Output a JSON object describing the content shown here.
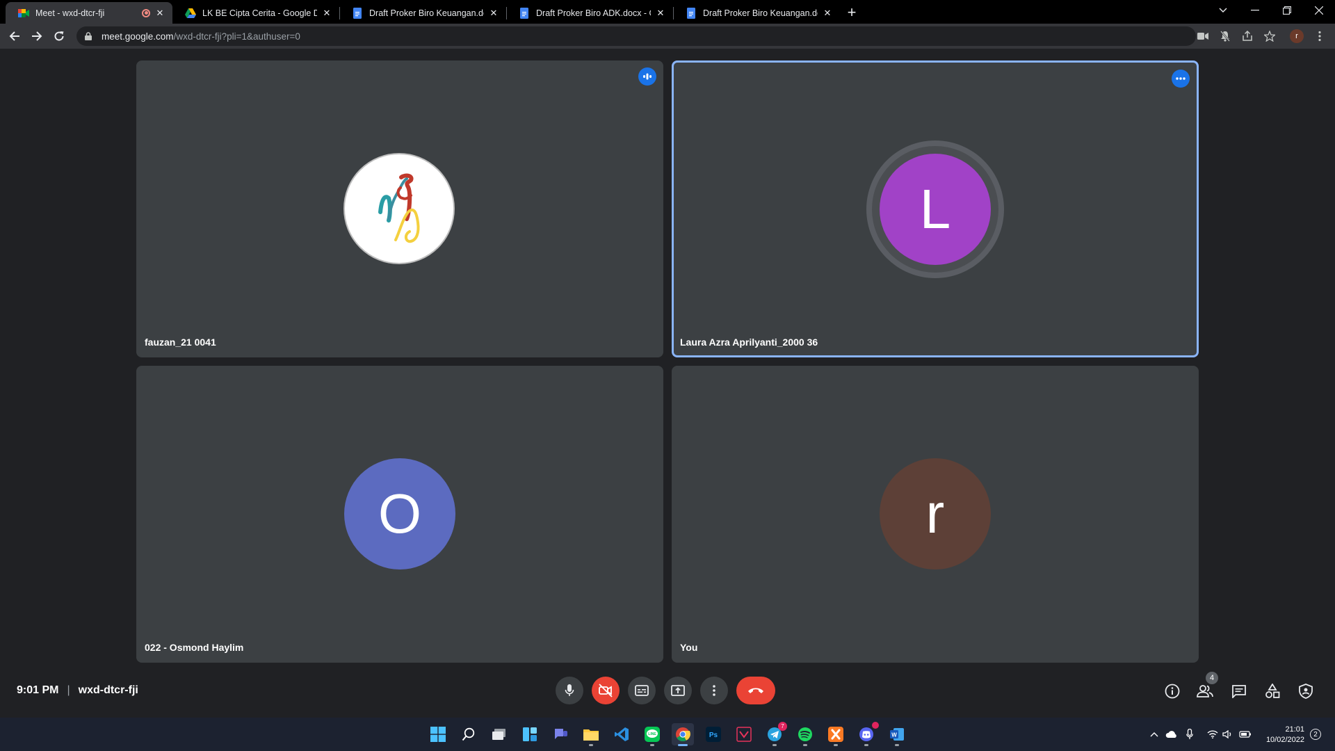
{
  "browser": {
    "tabs": [
      {
        "title": "Meet - wxd-dtcr-fji",
        "favicon": "meet-icon",
        "active": true,
        "recording": true
      },
      {
        "title": "LK BE Cipta Cerita - Google Drive",
        "favicon": "drive-icon"
      },
      {
        "title": "Draft Proker Biro Keuangan.docx",
        "favicon": "docs-icon"
      },
      {
        "title": "Draft Proker Biro ADK.docx - Goo",
        "favicon": "docs-icon"
      },
      {
        "title": "Draft Proker Biro Keuangan.docx",
        "favicon": "docs-icon"
      }
    ],
    "url_host": "meet.google.com",
    "url_path": "/wxd-dtcr-fji?pli=1&authuser=0",
    "profile_initial": "r"
  },
  "meet": {
    "participants": [
      {
        "name": "fauzan_21 0041",
        "avatar": "logo",
        "badge": "audio-indicator-icon"
      },
      {
        "name": "Laura Azra Aprilyanti_2000 36",
        "initial": "L",
        "avatar_color": "#a142c7",
        "speaking": true,
        "badge": "more-options-icon"
      },
      {
        "name": "022 - Osmond Haylim",
        "initial": "O",
        "avatar_color": "#5c6bc0"
      },
      {
        "name": "You",
        "initial": "r",
        "avatar_color": "#5d4037"
      }
    ],
    "time": "9:01 PM",
    "meeting_code": "wxd-dtcr-fji",
    "people_count": "4"
  },
  "taskbar": {
    "time": "21:01",
    "date": "10/02/2022",
    "notification_count": "2",
    "telegram_badge": "7"
  }
}
